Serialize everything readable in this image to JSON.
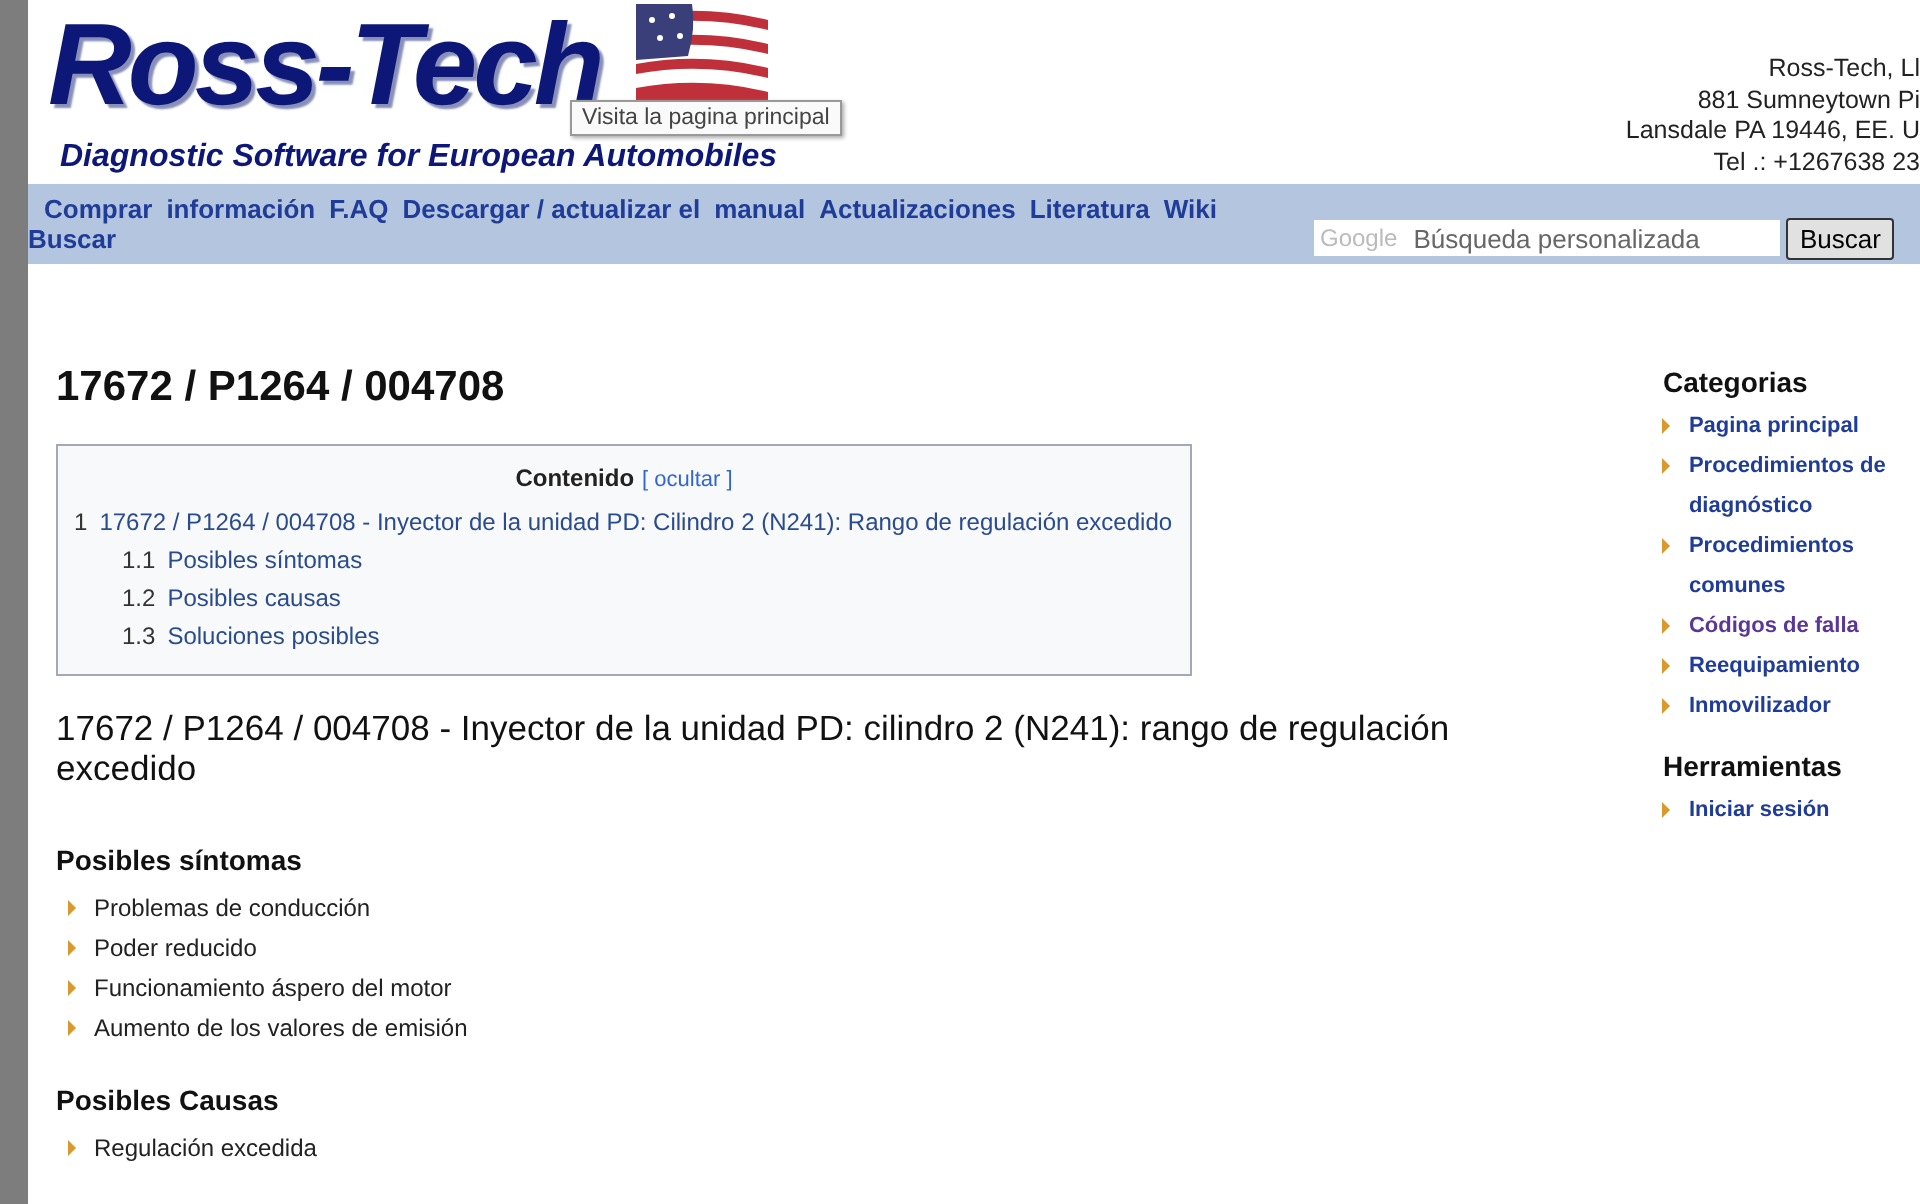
{
  "header": {
    "logo": "Ross-Tech",
    "tooltip": "Visita la pagina principal",
    "tagline": "Diagnostic Software for European Automobiles",
    "address": [
      "Ross-Tech, Ll",
      "881 Sumneytown Pi",
      "Lansdale PA 19446, EE. U",
      "Tel .: +1267638 23"
    ]
  },
  "nav": {
    "links": [
      "Comprar",
      "información",
      "F.AQ",
      "Descargar / actualizar el",
      "manual",
      "Actualizaciones",
      "Literatura",
      "Wiki",
      "Buscar"
    ],
    "search": {
      "brand": "Google",
      "placeholder": "Búsqueda personalizada",
      "button": "Buscar"
    }
  },
  "page": {
    "title": "17672 / P1264 / 004708",
    "toc": {
      "title": "Contenido",
      "toggle": "[ ocultar ]",
      "items": [
        {
          "number": "1",
          "label": "17672 / P1264 / 004708 - Inyector de la unidad PD: Cilindro 2 (N241): Rango de regulación excedido",
          "children": [
            {
              "number": "1.1",
              "label": "Posibles síntomas"
            },
            {
              "number": "1.2",
              "label": "Posibles causas"
            },
            {
              "number": "1.3",
              "label": "Soluciones posibles"
            }
          ]
        }
      ]
    },
    "heading": "17672 / P1264 / 004708 - Inyector de la unidad PD: cilindro 2 (N241): rango de regulación excedido",
    "sections": [
      {
        "title": "Posibles síntomas",
        "items": [
          "Problemas de conducción",
          "Poder reducido",
          "Funcionamiento áspero del motor",
          "Aumento de los valores de emisión"
        ]
      },
      {
        "title": "Posibles Causas",
        "items": [
          "Regulación excedida"
        ]
      }
    ]
  },
  "sidebar": [
    {
      "title": "Categorias",
      "links": [
        {
          "label": "Pagina principal",
          "visited": false
        },
        {
          "label": "Procedimientos de diagnóstico",
          "visited": false
        },
        {
          "label": "Procedimientos comunes",
          "visited": false
        },
        {
          "label": "Códigos de falla",
          "visited": true
        },
        {
          "label": "Reequipamiento",
          "visited": false
        },
        {
          "label": "Inmovilizador",
          "visited": false
        }
      ]
    },
    {
      "title": "Herramientas",
      "links": [
        {
          "label": "Iniciar sesión",
          "visited": false
        }
      ]
    }
  ]
}
